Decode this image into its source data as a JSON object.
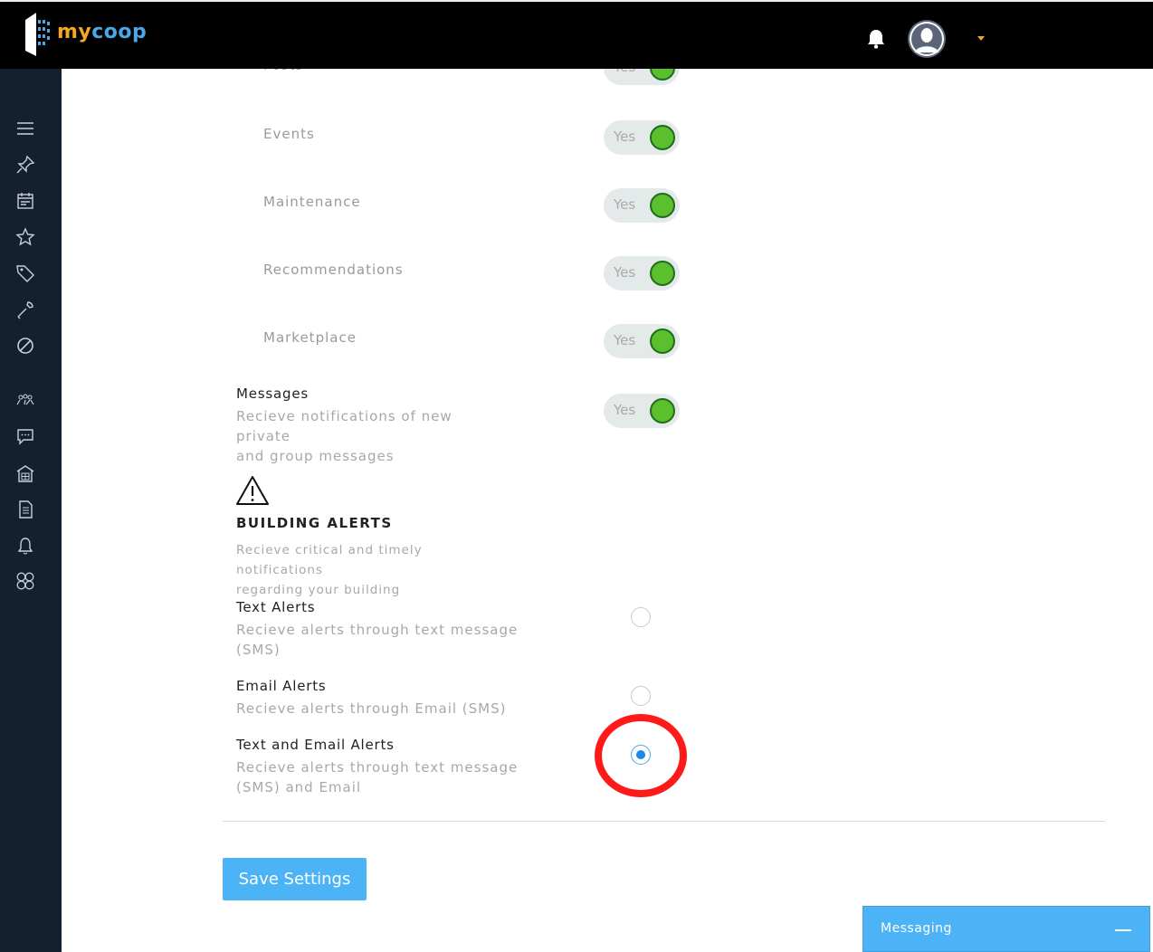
{
  "header": {
    "logo_my": "my",
    "logo_coop": "coop"
  },
  "notification_rows": [
    {
      "label": "Posts",
      "toggle": "Yes"
    },
    {
      "label": "Events",
      "toggle": "Yes"
    },
    {
      "label": "Maintenance",
      "toggle": "Yes"
    },
    {
      "label": "Recommendations",
      "toggle": "Yes"
    },
    {
      "label": "Marketplace",
      "toggle": "Yes"
    }
  ],
  "messages": {
    "title": "Messages",
    "desc_line1": "Recieve notifications of new private",
    "desc_line2": "and group messages",
    "toggle": "Yes"
  },
  "building_alerts": {
    "title": "BUILDING ALERTS",
    "desc_line1": "Recieve critical and timely notifications",
    "desc_line2": "regarding your building",
    "options": [
      {
        "title": "Text Alerts",
        "desc_line1": "Recieve alerts through text message",
        "desc_line2": "(SMS)",
        "selected": false
      },
      {
        "title": "Email Alerts",
        "desc_line1": "Recieve alerts through Email (SMS)",
        "desc_line2": "",
        "selected": false
      },
      {
        "title": "Text and Email Alerts",
        "desc_line1": "Recieve alerts through text message",
        "desc_line2": "(SMS) and Email",
        "selected": true
      }
    ]
  },
  "save_button": "Save Settings",
  "messaging": {
    "label": "Messaging"
  },
  "colors": {
    "toggle_on": "#5bbf2e",
    "accent": "#4db3f7",
    "highlight": "#ff1a1a"
  }
}
